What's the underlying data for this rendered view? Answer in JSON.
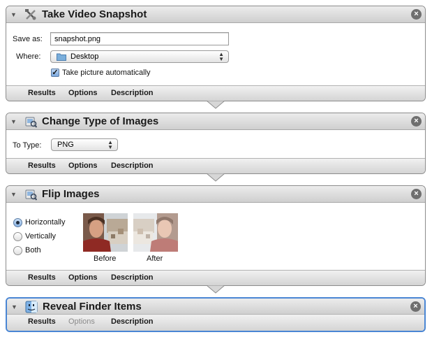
{
  "colors": {
    "selection_border": "#4a86d4",
    "header_top": "#ececec",
    "header_bottom": "#cfcfcf"
  },
  "footer_tabs": {
    "results": "Results",
    "options": "Options",
    "description": "Description"
  },
  "actions": [
    {
      "title": "Take Video Snapshot",
      "icon": "video-snapshot-icon",
      "save_as_label": "Save as:",
      "save_as_value": "snapshot.png",
      "where_label": "Where:",
      "where_value": "Desktop",
      "where_icon": "folder-icon",
      "checkbox_label": "Take picture automatically",
      "checkbox_checked": true
    },
    {
      "title": "Change Type of Images",
      "icon": "preview-images-icon",
      "to_type_label": "To Type:",
      "to_type_value": "PNG"
    },
    {
      "title": "Flip Images",
      "icon": "preview-images-icon",
      "options": [
        "Horizontally",
        "Vertically",
        "Both"
      ],
      "selected_option": "Horizontally",
      "before_label": "Before",
      "after_label": "After"
    },
    {
      "title": "Reveal Finder Items",
      "icon": "finder-icon",
      "selected": true,
      "options_tab_disabled": true
    }
  ]
}
